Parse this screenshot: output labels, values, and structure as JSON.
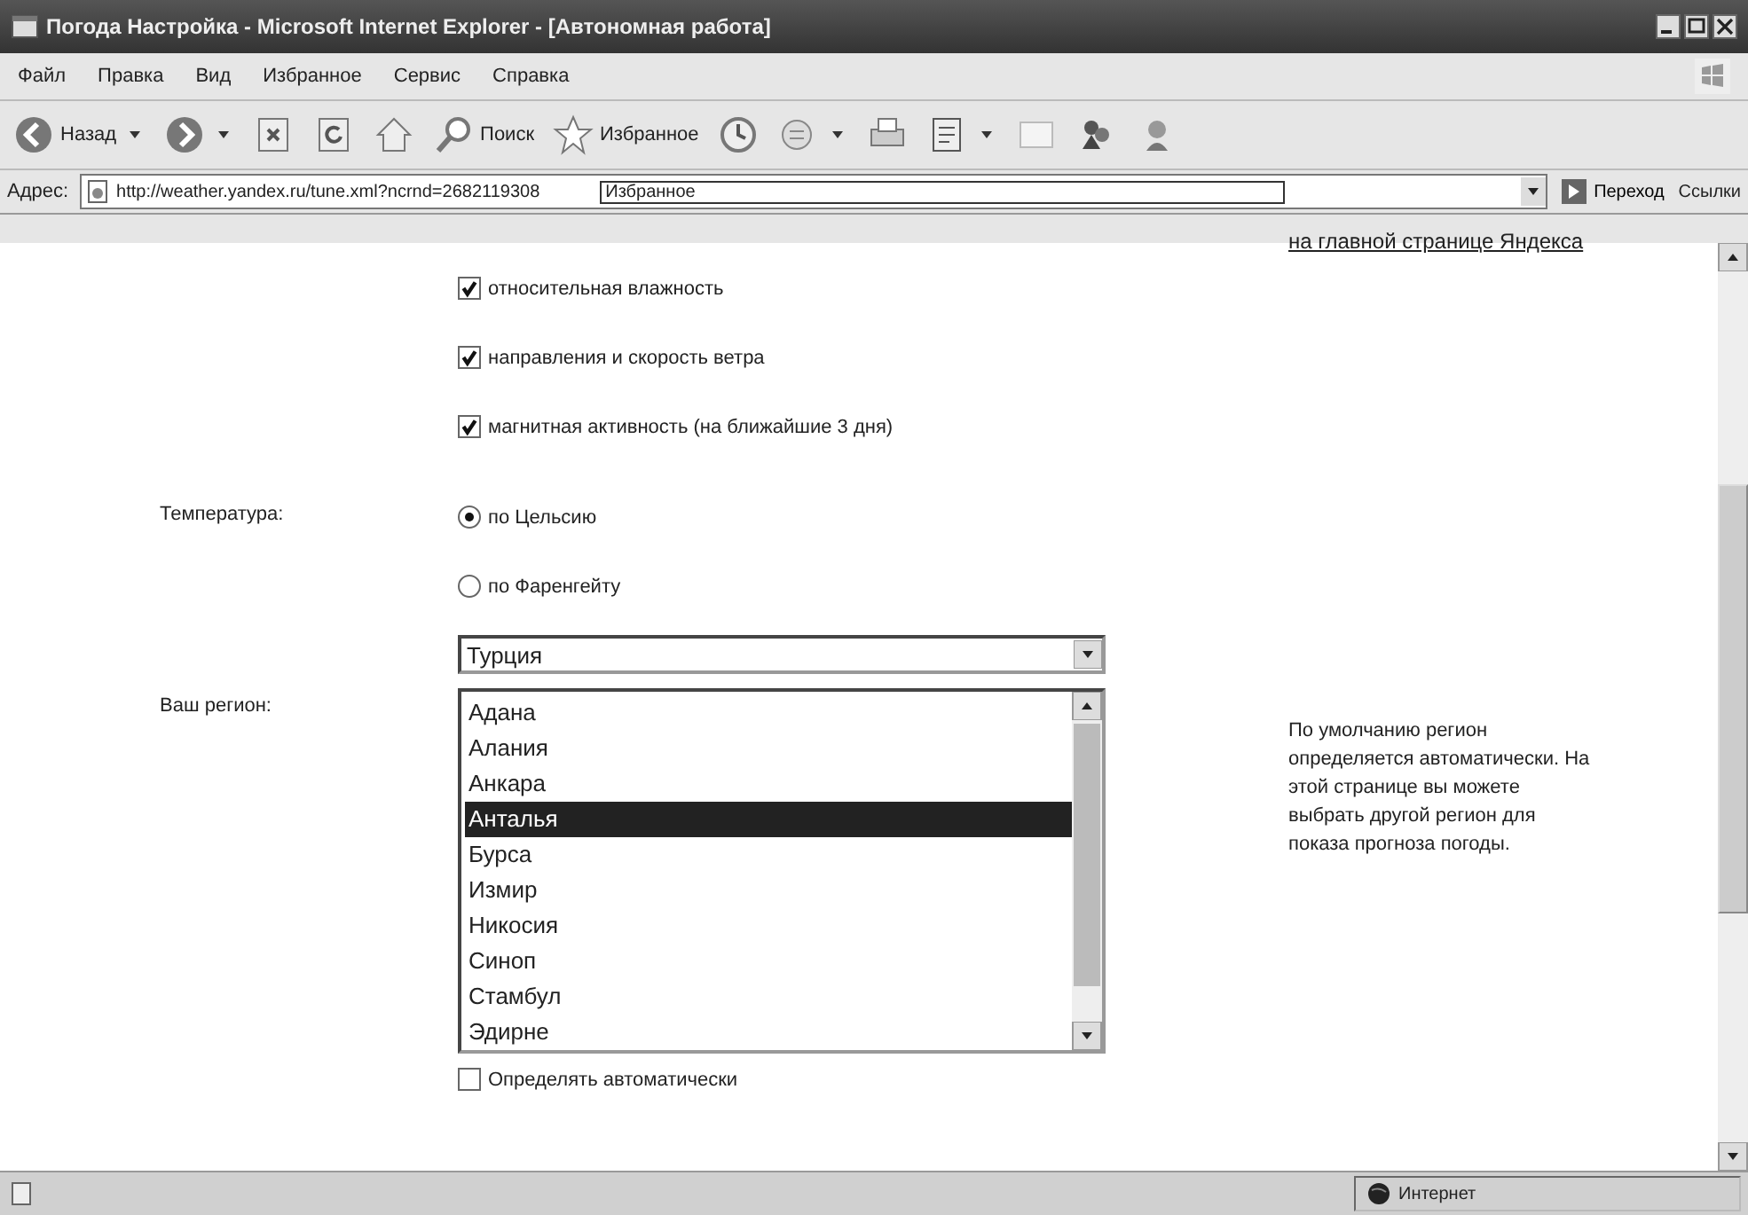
{
  "window": {
    "title": "Погода Настройка - Microsoft Internet Explorer - [Автономная работа]"
  },
  "menu": [
    "Файл",
    "Правка",
    "Вид",
    "Избранное",
    "Сервис",
    "Справка"
  ],
  "toolbar": [
    {
      "kind": "back",
      "label": "Назад"
    },
    {
      "kind": "forward"
    },
    {
      "kind": "stop"
    },
    {
      "kind": "refresh"
    },
    {
      "kind": "home"
    },
    {
      "kind": "search",
      "label": "Поиск"
    },
    {
      "kind": "favorites",
      "label": "Избранное"
    },
    {
      "kind": "history"
    },
    {
      "kind": "mail"
    },
    {
      "kind": "print"
    },
    {
      "kind": "edit"
    },
    {
      "kind": "discuss"
    },
    {
      "kind": "messenger"
    },
    {
      "kind": "research"
    }
  ],
  "address": {
    "label": "Адрес:",
    "value": "http://weather.yandex.ru/tune.xml?ncrnd=2682119308",
    "suggestion": "Избранное",
    "go": "Переход",
    "links": "Ссылки"
  },
  "page": {
    "top_link": "на главной странице Яндекса",
    "options": [
      {
        "label": "относительная влажность",
        "checked": true
      },
      {
        "label": "направления и скорость ветра",
        "checked": true
      },
      {
        "label": "магнитная активность (на ближайшие 3 дня)",
        "checked": true
      }
    ],
    "temperature": {
      "label": "Температура:",
      "units": [
        {
          "label": "по Цельсию",
          "selected": true
        },
        {
          "label": "по Фаренгейту",
          "selected": false
        }
      ]
    },
    "region": {
      "label": "Ваш регион:",
      "country": "Турция",
      "cities": [
        {
          "name": "Адана",
          "selected": false
        },
        {
          "name": "Алания",
          "selected": false
        },
        {
          "name": "Анкара",
          "selected": false
        },
        {
          "name": "Анталья",
          "selected": true
        },
        {
          "name": "Бурса",
          "selected": false
        },
        {
          "name": "Измир",
          "selected": false
        },
        {
          "name": "Никосия",
          "selected": false
        },
        {
          "name": "Синоп",
          "selected": false
        },
        {
          "name": "Стамбул",
          "selected": false
        },
        {
          "name": "Эдирне",
          "selected": false
        }
      ],
      "auto": {
        "label": "Определять автоматически",
        "checked": false
      },
      "help": "По умолчанию регион определяется автоматически. На этой странице вы можете выбрать другой регион для показа прогноза погоды."
    }
  },
  "status_bar": {
    "zone": "Интернет"
  }
}
